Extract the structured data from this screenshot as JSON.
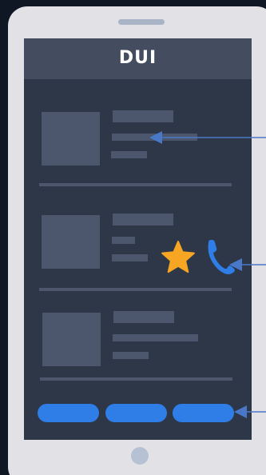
{
  "app": {
    "logo_text": "DUI"
  },
  "colors": {
    "screen_bg": "#2e3748",
    "header_bg": "#444d60",
    "placeholder": "#4c566d",
    "accent_blue": "#2f7ee8",
    "star": "#f6a623",
    "phone_frame": "#e2e2e6",
    "callout_line": "#4a78c8"
  },
  "list": {
    "items": [
      {
        "thumbnail": "image-placeholder",
        "text_lines": 3
      },
      {
        "thumbnail": "image-placeholder",
        "text_lines": 3,
        "actions": [
          "star-icon",
          "phone-icon"
        ]
      },
      {
        "thumbnail": "image-placeholder",
        "text_lines": 3
      }
    ]
  },
  "bottom_buttons": {
    "count": 3
  },
  "icons": {
    "favorite": "star-icon",
    "call": "phone-icon"
  }
}
